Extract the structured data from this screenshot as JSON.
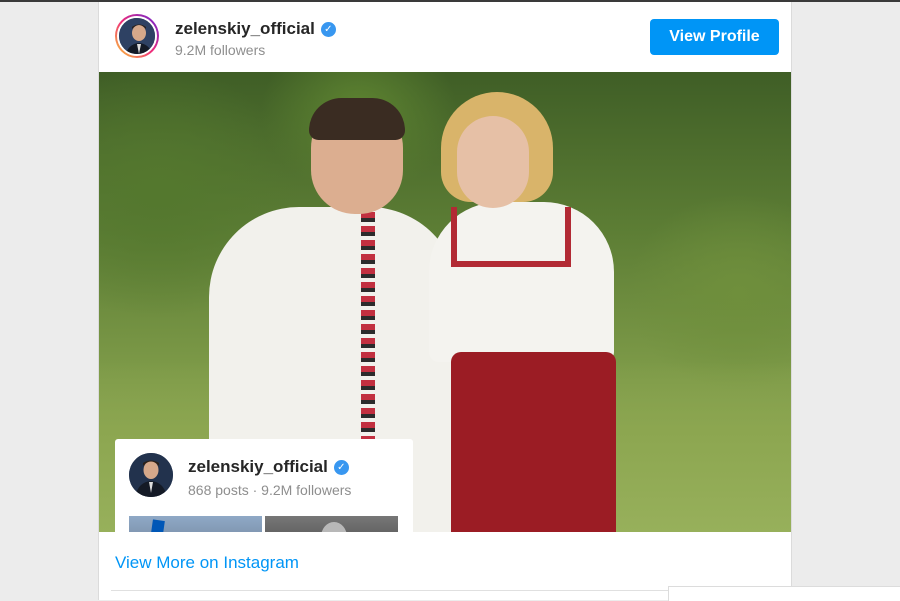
{
  "embed": {
    "username": "zelenskiy_official",
    "followers": "9.2M followers",
    "view_profile_label": "View Profile",
    "view_more_label": "View More on Instagram"
  },
  "overlay_card": {
    "username": "zelenskiy_official",
    "stats": "868 posts · 9.2M followers"
  },
  "icons": {
    "verified": "verified-badge-icon"
  },
  "colors": {
    "accent": "#0095f6",
    "verified": "#3897f0",
    "username": "#262626",
    "muted": "#8e8e8e"
  }
}
